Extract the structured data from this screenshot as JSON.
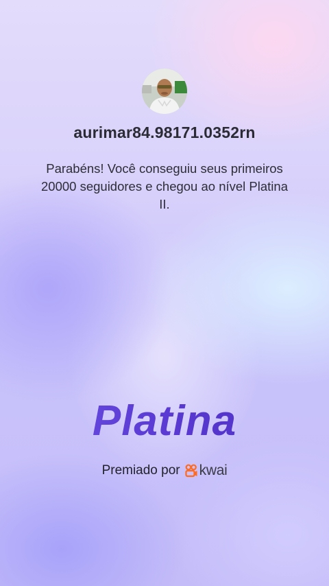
{
  "profile": {
    "username": "aurimar84.98171.0352rn",
    "avatar_icon": "user-avatar-photo"
  },
  "message": "Parabéns! Você conseguiu seus primeiros 20000 seguidores e chegou ao nível Platina II.",
  "level": {
    "name": "Platina",
    "color": "#5b3fd6"
  },
  "footer": {
    "awarded_by": "Premiado por",
    "brand_name": "kwai",
    "brand_icon": "kwai-logo-icon",
    "brand_color": "#ff6a1f"
  }
}
